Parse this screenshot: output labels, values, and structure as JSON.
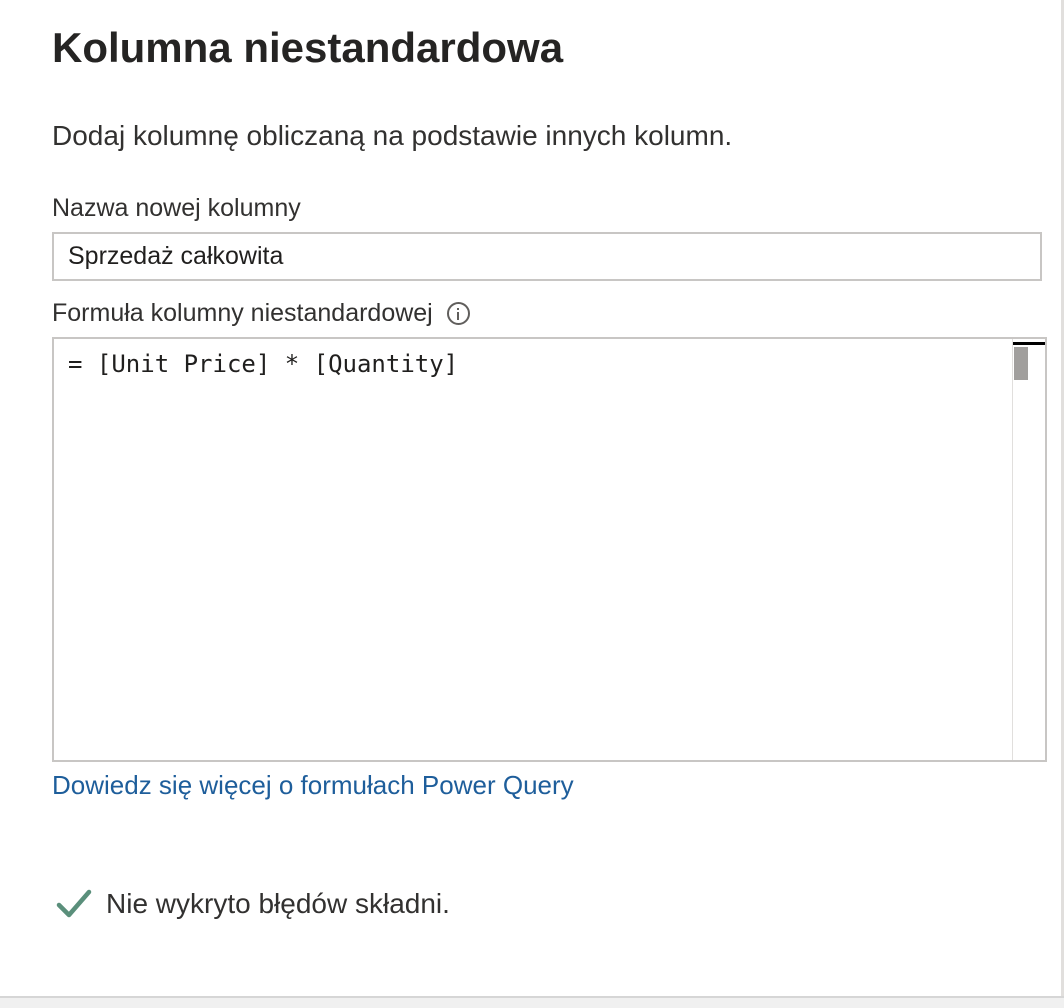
{
  "dialog": {
    "title": "Kolumna niestandardowa",
    "subtitle": "Dodaj kolumnę obliczaną na podstawie innych kolumn."
  },
  "name_field": {
    "label": "Nazwa nowej kolumny",
    "value": "Sprzedaż całkowita"
  },
  "formula_field": {
    "label": "Formuła kolumny niestandardowej",
    "info_icon": "info-icon",
    "value": "= [Unit Price] * [Quantity]"
  },
  "learn_more": {
    "text": "Dowiedz się więcej o formułach Power Query"
  },
  "status": {
    "icon": "checkmark-icon",
    "icon_color": "#5a8f7b",
    "text": "Nie wykryto błędów składni."
  },
  "colors": {
    "link": "#1e5e9b",
    "border": "#c8c6c4",
    "text": "#323130"
  }
}
